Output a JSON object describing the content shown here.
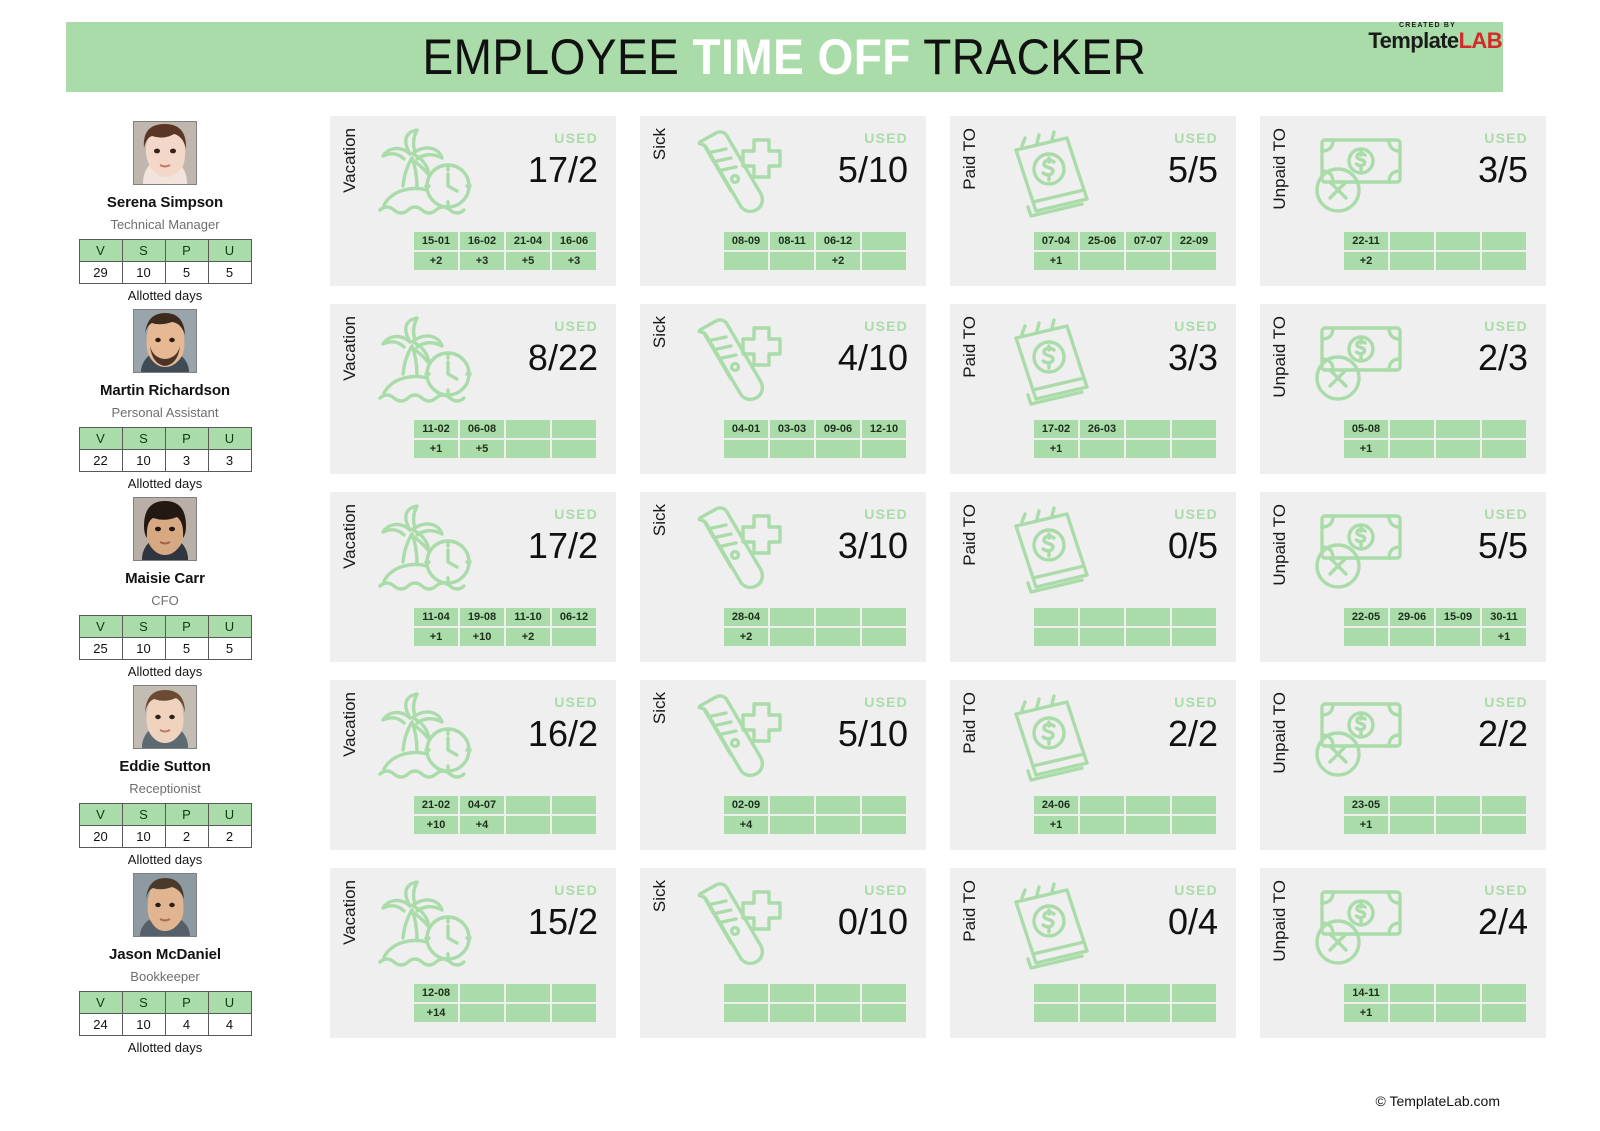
{
  "header": {
    "title_pre": "EMPLOYEE ",
    "title_hl": "TIME OFF",
    "title_post": " TRACKER",
    "band_color": "#a9dca8"
  },
  "logo": {
    "created_by": "CREATED BY",
    "brand_1": "Template",
    "brand_2": "LAB",
    "brand_2_color": "#d62828"
  },
  "allotted": {
    "caption": "Allotted days",
    "headers": [
      "V",
      "S",
      "P",
      "U"
    ]
  },
  "card_labels": {
    "used": "USED",
    "vacation": "Vacation",
    "sick": "Sick",
    "paid": "Paid TO",
    "unpaid": "Unpaid TO"
  },
  "employees": [
    {
      "name": "Serena Simpson",
      "role": "Technical Manager",
      "allotted": [
        "29",
        "10",
        "5",
        "5"
      ],
      "cards": [
        {
          "type": "vacation",
          "label": "Vacation",
          "used": "17/2",
          "dates": [
            "15-01",
            "16-02",
            "21-04",
            "16-06"
          ],
          "plus": [
            "+2",
            "+3",
            "+5",
            "+3"
          ]
        },
        {
          "type": "sick",
          "label": "Sick",
          "used": "5/10",
          "dates": [
            "08-09",
            "08-11",
            "06-12",
            ""
          ],
          "plus": [
            "",
            "",
            "+2",
            ""
          ]
        },
        {
          "type": "paid",
          "label": "Paid TO",
          "used": "5/5",
          "dates": [
            "07-04",
            "25-06",
            "07-07",
            "22-09"
          ],
          "plus": [
            "+1",
            "",
            "",
            ""
          ]
        },
        {
          "type": "unpaid",
          "label": "Unpaid TO",
          "used": "3/5",
          "dates": [
            "22-11",
            "",
            "",
            ""
          ],
          "plus": [
            "+2",
            "",
            "",
            ""
          ]
        }
      ]
    },
    {
      "name": "Martin Richardson",
      "role": "Personal Assistant",
      "allotted": [
        "22",
        "10",
        "3",
        "3"
      ],
      "cards": [
        {
          "type": "vacation",
          "label": "Vacation",
          "used": "8/22",
          "dates": [
            "11-02",
            "06-08",
            "",
            ""
          ],
          "plus": [
            "+1",
            "+5",
            "",
            ""
          ]
        },
        {
          "type": "sick",
          "label": "Sick",
          "used": "4/10",
          "dates": [
            "04-01",
            "03-03",
            "09-06",
            "12-10"
          ],
          "plus": [
            "",
            "",
            "",
            ""
          ]
        },
        {
          "type": "paid",
          "label": "Paid TO",
          "used": "3/3",
          "dates": [
            "17-02",
            "26-03",
            "",
            ""
          ],
          "plus": [
            "+1",
            "",
            "",
            ""
          ]
        },
        {
          "type": "unpaid",
          "label": "Unpaid TO",
          "used": "2/3",
          "dates": [
            "05-08",
            "",
            "",
            ""
          ],
          "plus": [
            "+1",
            "",
            "",
            ""
          ]
        }
      ]
    },
    {
      "name": "Maisie Carr",
      "role": "CFO",
      "allotted": [
        "25",
        "10",
        "5",
        "5"
      ],
      "cards": [
        {
          "type": "vacation",
          "label": "Vacation",
          "used": "17/2",
          "dates": [
            "11-04",
            "19-08",
            "11-10",
            "06-12"
          ],
          "plus": [
            "+1",
            "+10",
            "+2",
            ""
          ]
        },
        {
          "type": "sick",
          "label": "Sick",
          "used": "3/10",
          "dates": [
            "28-04",
            "",
            "",
            ""
          ],
          "plus": [
            "+2",
            "",
            "",
            ""
          ]
        },
        {
          "type": "paid",
          "label": "Paid TO",
          "used": "0/5",
          "dates": [
            "",
            "",
            "",
            ""
          ],
          "plus": [
            "",
            "",
            "",
            ""
          ]
        },
        {
          "type": "unpaid",
          "label": "Unpaid TO",
          "used": "5/5",
          "dates": [
            "22-05",
            "29-06",
            "15-09",
            "30-11"
          ],
          "plus": [
            "",
            "",
            "",
            "+1"
          ]
        }
      ]
    },
    {
      "name": "Eddie Sutton",
      "role": "Receptionist",
      "allotted": [
        "20",
        "10",
        "2",
        "2"
      ],
      "cards": [
        {
          "type": "vacation",
          "label": "Vacation",
          "used": "16/2",
          "dates": [
            "21-02",
            "04-07",
            "",
            ""
          ],
          "plus": [
            "+10",
            "+4",
            "",
            ""
          ]
        },
        {
          "type": "sick",
          "label": "Sick",
          "used": "5/10",
          "dates": [
            "02-09",
            "",
            "",
            ""
          ],
          "plus": [
            "+4",
            "",
            "",
            ""
          ]
        },
        {
          "type": "paid",
          "label": "Paid TO",
          "used": "2/2",
          "dates": [
            "24-06",
            "",
            "",
            ""
          ],
          "plus": [
            "+1",
            "",
            "",
            ""
          ]
        },
        {
          "type": "unpaid",
          "label": "Unpaid TO",
          "used": "2/2",
          "dates": [
            "23-05",
            "",
            "",
            ""
          ],
          "plus": [
            "+1",
            "",
            "",
            ""
          ]
        }
      ]
    },
    {
      "name": "Jason McDaniel",
      "role": "Bookkeeper",
      "allotted": [
        "24",
        "10",
        "4",
        "4"
      ],
      "cards": [
        {
          "type": "vacation",
          "label": "Vacation",
          "used": "15/2",
          "dates": [
            "12-08",
            "",
            "",
            ""
          ],
          "plus": [
            "+14",
            "",
            "",
            ""
          ]
        },
        {
          "type": "sick",
          "label": "Sick",
          "used": "0/10",
          "dates": [
            "",
            "",
            "",
            ""
          ],
          "plus": [
            "",
            "",
            "",
            ""
          ]
        },
        {
          "type": "paid",
          "label": "Paid TO",
          "used": "0/4",
          "dates": [
            "",
            "",
            "",
            ""
          ],
          "plus": [
            "",
            "",
            "",
            ""
          ]
        },
        {
          "type": "unpaid",
          "label": "Unpaid TO",
          "used": "2/4",
          "dates": [
            "14-11",
            "",
            "",
            ""
          ],
          "plus": [
            "+1",
            "",
            "",
            ""
          ]
        }
      ]
    }
  ],
  "footer": {
    "copyright": "© TemplateLab.com"
  }
}
